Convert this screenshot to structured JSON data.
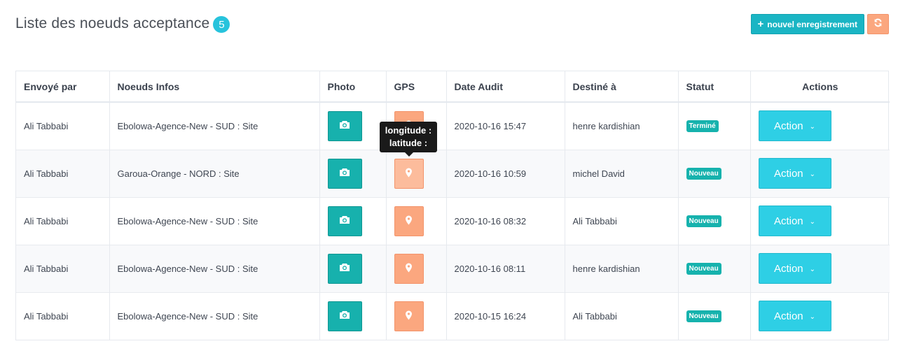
{
  "header": {
    "title": "Liste des noeuds acceptance",
    "count": "5"
  },
  "toolbar": {
    "new_label": "nouvel enregistrement",
    "new_icon": "plus-icon",
    "refresh_icon": "refresh-icon"
  },
  "table": {
    "columns": [
      "Envoyé par",
      "Noeuds Infos",
      "Photo",
      "GPS",
      "Date Audit",
      "Destiné à",
      "Statut",
      "Actions"
    ],
    "rows": [
      {
        "sender": "Ali Tabbabi",
        "info": "Ebolowa-Agence-New - SUD : Site",
        "date": "2020-10-16 15:47",
        "recipient": "henre kardishian",
        "status": "Terminé",
        "action": "Action"
      },
      {
        "sender": "Ali Tabbabi",
        "info": "Garoua-Orange - NORD : Site",
        "date": "2020-10-16 10:59",
        "recipient": "michel David",
        "status": "Nouveau",
        "action": "Action"
      },
      {
        "sender": "Ali Tabbabi",
        "info": "Ebolowa-Agence-New - SUD : Site",
        "date": "2020-10-16 08:32",
        "recipient": "Ali Tabbabi",
        "status": "Nouveau",
        "action": "Action"
      },
      {
        "sender": "Ali Tabbabi",
        "info": "Ebolowa-Agence-New - SUD : Site",
        "date": "2020-10-16 08:11",
        "recipient": "henre kardishian",
        "status": "Nouveau",
        "action": "Action"
      },
      {
        "sender": "Ali Tabbabi",
        "info": "Ebolowa-Agence-New - SUD : Site",
        "date": "2020-10-15 16:24",
        "recipient": "Ali Tabbabi",
        "status": "Nouveau",
        "action": "Action"
      }
    ]
  },
  "tooltip": {
    "line1": "longitude :",
    "line2": "latitude :"
  },
  "colors": {
    "accent": "#27c3dc",
    "teal": "#17b1ad",
    "orange": "#fba77f",
    "action": "#2ecfe5"
  }
}
